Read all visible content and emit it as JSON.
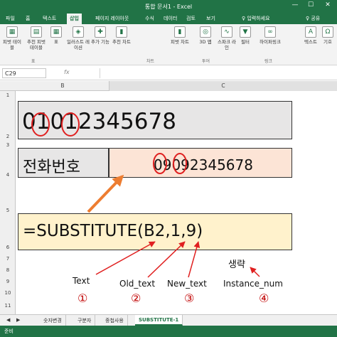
{
  "window": {
    "title": "통합 문서1 - Excel",
    "min": "—",
    "max": "☐",
    "close": "✕"
  },
  "tabs": {
    "items": [
      "파일",
      "홈",
      "텍스트",
      "삽입",
      "페이지 레이아웃",
      "수식",
      "데이터",
      "검토",
      "보기"
    ],
    "active": "삽입",
    "tell_me": "♀ 입력하세요",
    "share": "♀ 공유"
  },
  "ribbon": {
    "buttons": [
      {
        "label": "피벗 테이블",
        "icon": "pivot-table-icon",
        "glyph": "▦"
      },
      {
        "label": "추천 피벗 테이블",
        "icon": "recommended-pivot-icon",
        "glyph": "▤"
      },
      {
        "label": "표",
        "icon": "table-icon",
        "glyph": "▦"
      },
      {
        "label": "일러스트 레이션",
        "icon": "illustration-icon",
        "glyph": "◈"
      },
      {
        "label": "추가 기능",
        "icon": "addin-icon",
        "glyph": "✚"
      },
      {
        "label": "추천 차트",
        "icon": "recommended-chart-icon",
        "glyph": "▮"
      },
      {
        "label": "피벗 차트",
        "icon": "pivot-chart-icon",
        "glyph": "▮"
      },
      {
        "label": "3D 맵",
        "icon": "3d-map-icon",
        "glyph": "◎"
      },
      {
        "label": "스파크 라인",
        "icon": "sparkline-icon",
        "glyph": "∿"
      },
      {
        "label": "필터",
        "icon": "filter-icon",
        "glyph": "▼"
      },
      {
        "label": "하이퍼링크",
        "icon": "hyperlink-icon",
        "glyph": "∞"
      },
      {
        "label": "텍스트",
        "icon": "text-icon",
        "glyph": "A"
      },
      {
        "label": "기호",
        "icon": "symbol-icon",
        "glyph": "Ω"
      }
    ],
    "groups": [
      "표",
      "차트",
      "투어",
      "링크"
    ]
  },
  "formula_bar": {
    "name_box": "C29",
    "fx": "fx",
    "value": ""
  },
  "columns": [
    "B",
    "C"
  ],
  "rows": [
    "1",
    "2",
    "3",
    "4",
    "5",
    "6",
    "7",
    "8",
    "9",
    "10",
    "11"
  ],
  "cells": {
    "b2": "01012345678",
    "b4": "전화번호",
    "c4": "09092345678",
    "formula": "=SUBSTITUTE(B2,1,9)"
  },
  "annotations": {
    "text_label": "Text",
    "old_text_label": "Old_text",
    "new_text_label": "New_text",
    "instance_num_label": "Instance_num",
    "omitted": "생략",
    "n1": "①",
    "n2": "②",
    "n3": "③",
    "n4": "④"
  },
  "sheet_tabs": {
    "items": [
      "숫자변경",
      "구분자",
      "중첩사용",
      "SUBSTITUTE-1"
    ],
    "active": "SUBSTITUTE-1"
  },
  "status": {
    "ready": "준비"
  },
  "colors": {
    "excel_green": "#217346",
    "annotation_red": "#e02020",
    "arrow_orange": "#ed7d31"
  }
}
